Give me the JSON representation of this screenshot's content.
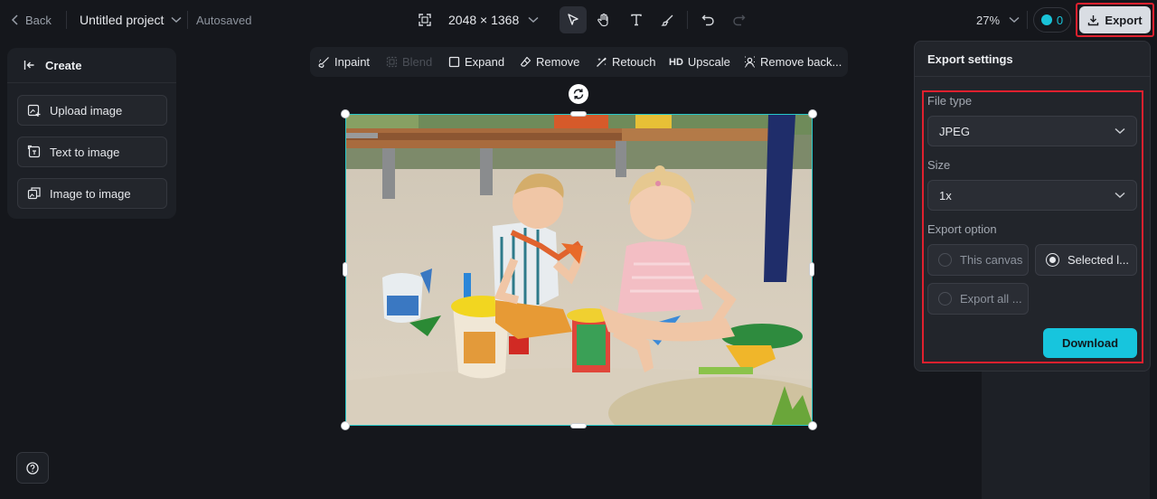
{
  "topbar": {
    "back_label": "Back",
    "project_name": "Untitled project",
    "status": "Autosaved",
    "dimensions": "2048 × 1368",
    "zoom": "27%",
    "credits": "0",
    "export_label": "Export"
  },
  "create_panel": {
    "title": "Create",
    "items": [
      {
        "label": "Upload image",
        "icon": "upload-image-icon"
      },
      {
        "label": "Text to image",
        "icon": "text-to-image-icon"
      },
      {
        "label": "Image to image",
        "icon": "image-to-image-icon"
      }
    ]
  },
  "ai_toolbar": {
    "items": [
      {
        "label": "Inpaint",
        "enabled": true
      },
      {
        "label": "Blend",
        "enabled": false
      },
      {
        "label": "Expand",
        "enabled": true
      },
      {
        "label": "Remove",
        "enabled": true
      },
      {
        "label": "Retouch",
        "enabled": true
      },
      {
        "label": "Upscale",
        "badge": "HD",
        "enabled": true
      },
      {
        "label": "Remove back...",
        "enabled": true
      }
    ]
  },
  "export_panel": {
    "title": "Export settings",
    "file_type_label": "File type",
    "file_type_value": "JPEG",
    "size_label": "Size",
    "size_value": "1x",
    "option_label": "Export option",
    "options": [
      {
        "label": "This canvas",
        "selected": false
      },
      {
        "label": "Selected l...",
        "selected": true
      },
      {
        "label": "Export all ...",
        "selected": false
      }
    ],
    "download_label": "Download"
  },
  "colors": {
    "accent": "#17c5dd",
    "selection": "#27c7c8",
    "highlight": "#e0202e",
    "background": "#15171c",
    "panel": "#22252b"
  }
}
